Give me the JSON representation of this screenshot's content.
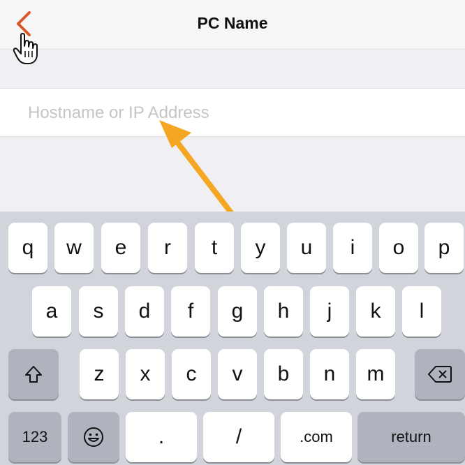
{
  "nav": {
    "title": "PC Name",
    "back_icon": "chevron-left-icon",
    "accent_color": "#d9572a"
  },
  "form": {
    "host_placeholder": "Hostname or IP Address",
    "host_value": ""
  },
  "keyboard": {
    "row1": [
      "q",
      "w",
      "e",
      "r",
      "t",
      "y",
      "u",
      "i",
      "o",
      "p"
    ],
    "row2": [
      "a",
      "s",
      "d",
      "f",
      "g",
      "h",
      "j",
      "k",
      "l"
    ],
    "row3": [
      "z",
      "x",
      "c",
      "v",
      "b",
      "n",
      "m"
    ],
    "shift_icon": "shift-arrow-icon",
    "delete_icon": "backspace-icon",
    "numbers_label": "123",
    "emoji_icon": "emoji-icon",
    "dot_label": ".",
    "slash_label": "/",
    "dotcom_label": ".com",
    "return_label": "return"
  },
  "annotation": {
    "arrow_color": "#f5a623",
    "arrow_icon": "pointer-arrow-icon",
    "cursor_icon": "hand-cursor-icon"
  }
}
